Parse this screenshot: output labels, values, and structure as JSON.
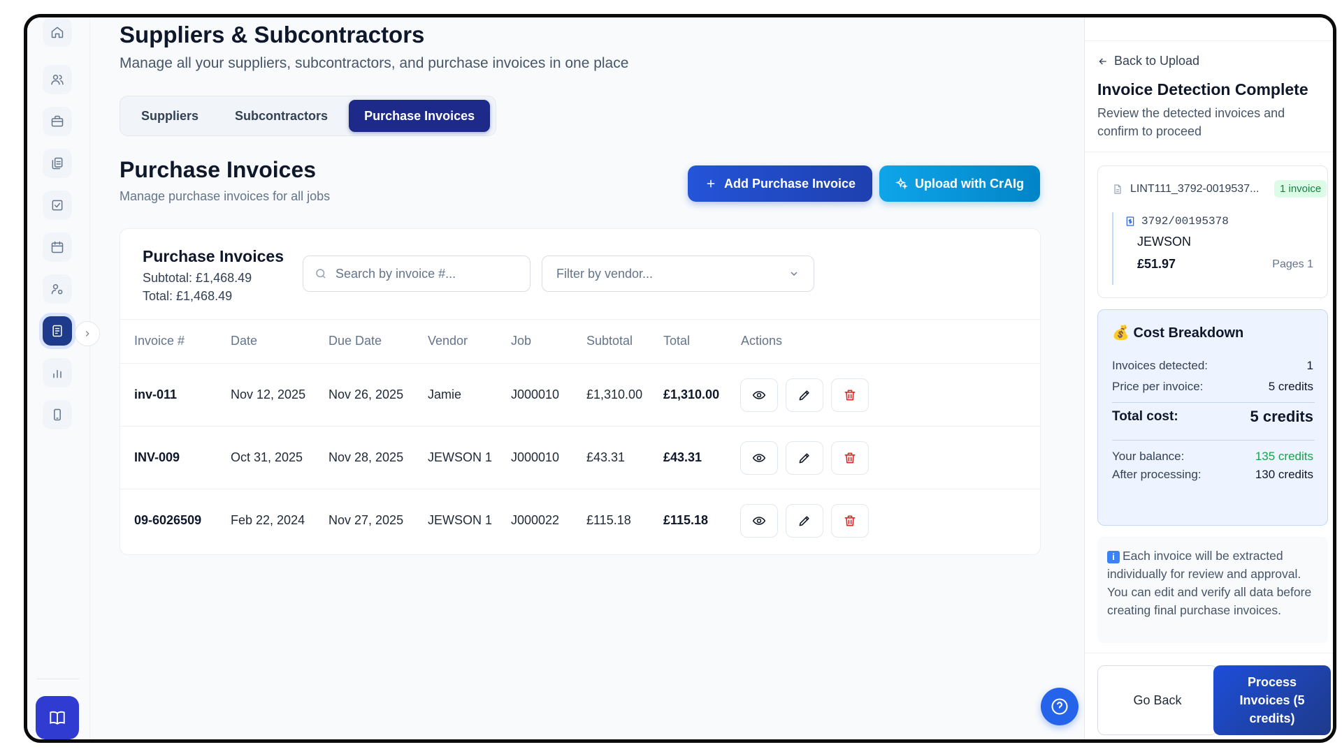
{
  "page": {
    "title": "Suppliers & Subcontractors",
    "subtitle": "Manage all your suppliers, subcontractors, and purchase invoices in one place"
  },
  "tabs": [
    {
      "label": "Suppliers",
      "active": false
    },
    {
      "label": "Subcontractors",
      "active": false
    },
    {
      "label": "Purchase Invoices",
      "active": true
    }
  ],
  "section": {
    "title": "Purchase Invoices",
    "subtitle": "Manage purchase invoices for all jobs",
    "add_button": "Add Purchase Invoice",
    "upload_button": "Upload with CrAIg"
  },
  "card": {
    "title": "Purchase Invoices",
    "subtotal": "Subtotal: £1,468.49",
    "total": "Total: £1,468.49",
    "search_placeholder": "Search by invoice #...",
    "filter_placeholder": "Filter by vendor..."
  },
  "table": {
    "headers": [
      "Invoice #",
      "Date",
      "Due Date",
      "Vendor",
      "Job",
      "Subtotal",
      "Total",
      "Actions"
    ],
    "rows": [
      {
        "invoice": "inv-011",
        "date": "Nov 12, 2025",
        "due": "Nov 26, 2025",
        "vendor": "Jamie",
        "job": "J000010",
        "subtotal": "£1,310.00",
        "total": "£1,310.00"
      },
      {
        "invoice": "INV-009",
        "date": "Oct 31, 2025",
        "due": "Nov 28, 2025",
        "vendor": "JEWSON 1",
        "job": "J000010",
        "subtotal": "£43.31",
        "total": "£43.31"
      },
      {
        "invoice": "09-6026509",
        "date": "Feb 22, 2024",
        "due": "Nov 27, 2025",
        "vendor": "JEWSON 1",
        "job": "J000022",
        "subtotal": "£115.18",
        "total": "£115.18"
      }
    ]
  },
  "sidebar": {
    "icons": [
      "home-icon",
      "users-icon",
      "briefcase-icon",
      "documents-icon",
      "checklist-icon",
      "calendar-icon",
      "user-settings-icon",
      "invoice-icon",
      "chart-icon",
      "mobile-icon",
      "book-icon"
    ]
  },
  "panel": {
    "back_label": "Back to Upload",
    "title": "Invoice Detection Complete",
    "description": "Review the detected invoices and confirm to proceed",
    "file_name": "LINT111_3792-0019537...",
    "file_badge": "1 invoice",
    "invoice_number": "3792/00195378",
    "invoice_vendor": "JEWSON",
    "invoice_amount": "£51.97",
    "invoice_pages": "Pages 1",
    "cost": {
      "title": "💰 Cost Breakdown",
      "detected_label": "Invoices detected:",
      "detected_value": "1",
      "price_label": "Price per invoice:",
      "price_value": "5 credits",
      "total_label": "Total cost:",
      "total_value": "5 credits",
      "balance_label": "Your balance:",
      "balance_value": "135 credits",
      "after_label": "After processing:",
      "after_value": "130 credits"
    },
    "info_icon": "i",
    "info_text": "Each invoice will be extracted individually for review and approval. You can edit and verify all data before creating final purchase invoices.",
    "go_back": "Go Back",
    "process": "Process Invoices (5 credits)"
  },
  "colors": {
    "accent": "#1e2a8a",
    "primary_button": "#2454d8",
    "upload_button": "#0ea5e9",
    "success": "#16a34a",
    "danger": "#dc2626"
  }
}
